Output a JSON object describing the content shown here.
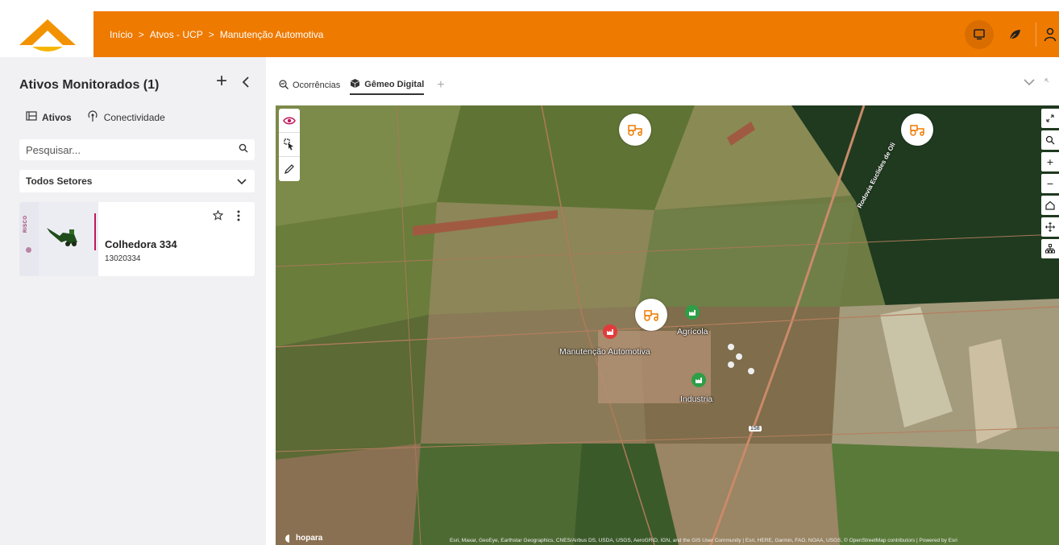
{
  "header": {
    "breadcrumbs": [
      "Início",
      "Atvos - UCP",
      "Manutenção Automotiva"
    ],
    "separator": ">",
    "icons": [
      "monitor-icon",
      "leaf-icon",
      "user-icon"
    ],
    "brand_color": "#ef7a00"
  },
  "left_panel": {
    "title": "Ativos Monitorados (1)",
    "tabs": [
      {
        "label": "Ativos",
        "icon": "list-icon",
        "active": true
      },
      {
        "label": "Conectividade",
        "icon": "antenna-icon",
        "active": false
      }
    ],
    "search": {
      "placeholder": "Pesquisar..."
    },
    "sector_select": {
      "value": "Todos Setores"
    },
    "assets": [
      {
        "risk_label": "RISCO",
        "name": "Colhedora 334",
        "code": "13020334"
      }
    ]
  },
  "main": {
    "tabs": [
      {
        "label": "Ocorrências",
        "icon": "search-chart-icon",
        "active": false
      },
      {
        "label": "Gêmeo Digital",
        "icon": "cube-icon",
        "active": true
      }
    ],
    "map": {
      "facilities": [
        {
          "label": "Manutenção Automotiva",
          "status": "red"
        },
        {
          "label": "Agrícola",
          "status": "green"
        },
        {
          "label": "Industria",
          "status": "green"
        }
      ],
      "road_label": "Rodovia Euclides de Oli",
      "highway_shield": "158",
      "brand": "hopara",
      "attribution": "Esri, Maxar, GeoEye, Earthstar Geographics, CNES/Airbus DS, USDA, USGS, AeroGRID, IGN, and the GIS User Community | Esri, HERE, Garmin, FAO, NOAA, USGS, © OpenStreetMap contributors | Powered by Esri"
    }
  }
}
